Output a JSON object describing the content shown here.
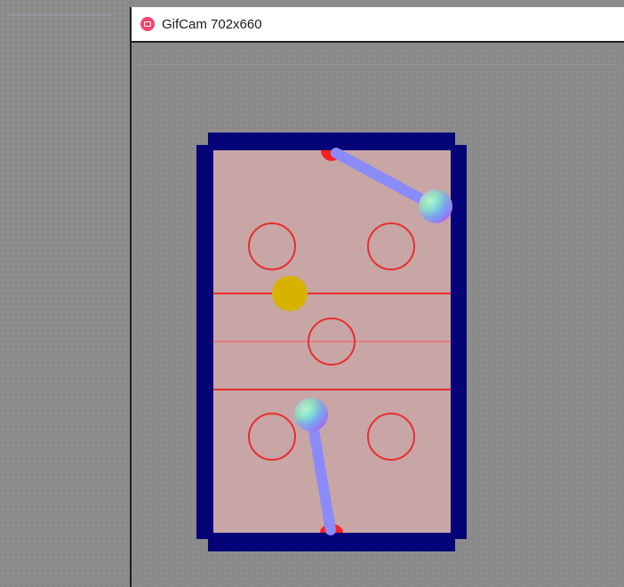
{
  "window": {
    "title": "GifCam 702x660",
    "icon": "gifcam-app-icon"
  },
  "game": {
    "type": "air-hockey",
    "colors": {
      "border": "#050378",
      "table_surface": "#c8a6a6",
      "markings": "#e82e2e",
      "center_line": "#ea7a7a",
      "puck": "#d8b200",
      "goal": "#ff2020",
      "rod": "#8a8af8"
    },
    "pieces": {
      "puck": "yellow-puck",
      "top_mallet": "rainbow-sphere-mallet",
      "bottom_mallet": "rainbow-sphere-mallet"
    }
  }
}
